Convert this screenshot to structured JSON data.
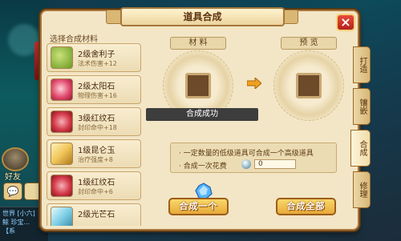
{
  "background": {
    "friend_label": "好友",
    "chat_lines": [
      "世界 [小六]",
      "鲸 珍宝...",
      "【系"
    ]
  },
  "title": "道具合成",
  "close_icon": "close-icon",
  "list_title": "选择合成材料",
  "materials": [
    {
      "name": "2级舍利子",
      "desc": "法术伤害+12",
      "icon": "green-seeds-icon",
      "color": "#8bbf3a"
    },
    {
      "name": "2级太阳石",
      "desc": "物理伤害+16",
      "icon": "red-orb-icon",
      "color": "#e0486b"
    },
    {
      "name": "3级红纹石",
      "desc": "封印命中+18",
      "icon": "red-swirl-icon",
      "color": "#d53a4a"
    },
    {
      "name": "1级昆仑玉",
      "desc": "治疗强度+8",
      "icon": "jade-icon",
      "color": "#f0c65a"
    },
    {
      "name": "1级红纹石",
      "desc": "封印命中+6",
      "icon": "red-swirl-icon",
      "color": "#d53a4a"
    },
    {
      "name": "2级光芒石",
      "desc": "",
      "icon": "crystal-icon",
      "color": "#7fd0e6"
    }
  ],
  "material_label": "材 料",
  "preview_label": "预 览",
  "toast": "合成成功",
  "info": {
    "line1": "· 一定数量的低级道具可合成一个高级道具",
    "line2": "· 合成一次花费",
    "cost": "0"
  },
  "buttons": {
    "one": "合成一个",
    "all": "合成全部"
  },
  "tabs": [
    "打造",
    "镶嵌",
    "合成",
    "修理"
  ],
  "active_tab": "合成",
  "colors": {
    "accent": "#e7a93a",
    "frame": "#a9753a",
    "panel": "#f3e6c6"
  }
}
